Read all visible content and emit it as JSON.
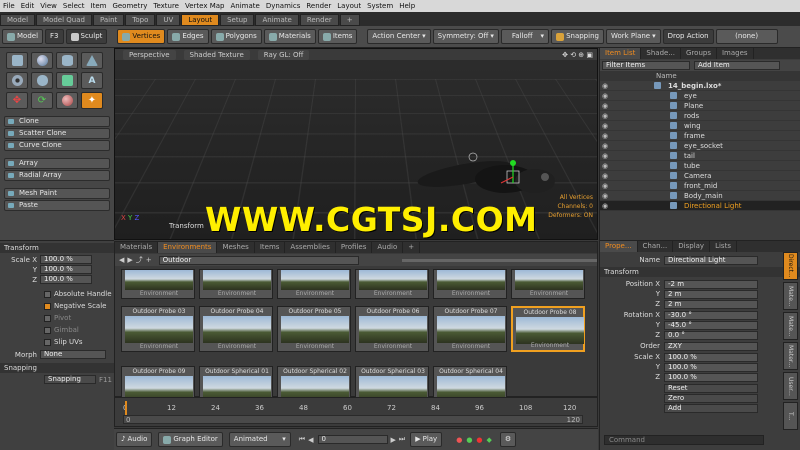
{
  "menubar": [
    "File",
    "Edit",
    "View",
    "Select",
    "Item",
    "Geometry",
    "Texture",
    "Vertex Map",
    "Animate",
    "Dynamics",
    "Render",
    "Layout",
    "System",
    "Help"
  ],
  "layout_tabs": [
    {
      "label": "Model",
      "active": false
    },
    {
      "label": "Model Quad",
      "active": false
    },
    {
      "label": "Paint",
      "active": false
    },
    {
      "label": "Topo",
      "active": false
    },
    {
      "label": "UV",
      "active": false
    },
    {
      "label": "Layout",
      "active": true
    },
    {
      "label": "Setup",
      "active": false
    },
    {
      "label": "Animate",
      "active": false
    },
    {
      "label": "Render",
      "active": false
    },
    {
      "label": "+",
      "active": false
    }
  ],
  "toolbar": {
    "model": "Model",
    "f3": "F3",
    "sculpt": "Sculpt",
    "vertices": "Vertices",
    "edges": "Edges",
    "polygons": "Polygons",
    "materials": "Materials",
    "items": "Items",
    "action_center": "Action Center",
    "symmetry": "Symmetry: Off",
    "falloff": "Falloff",
    "snapping": "Snapping",
    "work_plane": "Work Plane",
    "drop_action": "Drop Action",
    "none": "(none)"
  },
  "left_buttons": [
    "Clone",
    "Scatter Clone",
    "Curve Clone",
    "Array",
    "Radial Array",
    "Mesh Paint",
    "Paste"
  ],
  "viewport": {
    "perspective": "Perspective",
    "shaded": "Shaded Texture",
    "raygl": "Ray GL: Off",
    "transform": "Transform",
    "info_vertices": "All Vertices",
    "info_channels": "Channels: 0",
    "info_sel": "Deformers: ON"
  },
  "watermark": "WWW.CGTSJ.COM",
  "itemlist": {
    "tabs": [
      {
        "label": "Item List",
        "active": true
      },
      {
        "label": "Shade...",
        "active": false
      },
      {
        "label": "Groups",
        "active": false
      },
      {
        "label": "Images",
        "active": false
      }
    ],
    "filter": "Filter Items",
    "add_item": "Add Item",
    "name_header": "Name",
    "items": [
      {
        "name": "14_begin.lxo*",
        "selected": false
      },
      {
        "name": "eye",
        "selected": false
      },
      {
        "name": "Plane",
        "selected": false
      },
      {
        "name": "rods",
        "selected": false
      },
      {
        "name": "wing",
        "selected": false
      },
      {
        "name": "frame",
        "selected": false
      },
      {
        "name": "eye_socket",
        "selected": false
      },
      {
        "name": "tail",
        "selected": false
      },
      {
        "name": "tube",
        "selected": false
      },
      {
        "name": "Camera",
        "selected": false
      },
      {
        "name": "front_mid",
        "selected": false
      },
      {
        "name": "Body_main",
        "selected": false
      },
      {
        "name": "Directional Light",
        "selected": true
      }
    ]
  },
  "transform_panel": {
    "title": "Transform",
    "scale_x_label": "Scale X",
    "scale_x": "100.0 %",
    "y_label": "Y",
    "scale_y": "100.0 %",
    "z_label": "Z",
    "scale_z": "100.0 %",
    "absolute_handle": "Absolute Handle",
    "negative_scale": "Negative Scale",
    "pivot": "Pivot",
    "gimbal": "Gimbal",
    "slip_uvs": "Slip UVs",
    "morph_label": "Morph",
    "morph": "None",
    "snapping_title": "Snapping",
    "snapping": "Snapping",
    "snapping_key": "F11"
  },
  "browser": {
    "tabs": [
      {
        "label": "Materials",
        "active": false
      },
      {
        "label": "Environments",
        "active": true
      },
      {
        "label": "Meshes",
        "active": false
      },
      {
        "label": "Items",
        "active": false
      },
      {
        "label": "Assemblies",
        "active": false
      },
      {
        "label": "Profiles",
        "active": false
      },
      {
        "label": "Audio",
        "active": false
      },
      {
        "label": "+",
        "active": false
      }
    ],
    "path": "Outdoor",
    "row0": [
      "Environment",
      "Environment",
      "Environment",
      "Environment",
      "Environment",
      "Environment"
    ],
    "presets": [
      {
        "name": "Outdoor Probe 03",
        "foot": "Environment",
        "selected": false
      },
      {
        "name": "Outdoor Probe 04",
        "foot": "Environment",
        "selected": false
      },
      {
        "name": "Outdoor Probe 05",
        "foot": "Environment",
        "selected": false
      },
      {
        "name": "Outdoor Probe 06",
        "foot": "Environment",
        "selected": false
      },
      {
        "name": "Outdoor Probe 07",
        "foot": "Environment",
        "selected": false
      },
      {
        "name": "Outdoor Probe 08",
        "foot": "Environment",
        "selected": true
      },
      {
        "name": "Outdoor Probe 09",
        "foot": "",
        "selected": false
      },
      {
        "name": "Outdoor Spherical 01",
        "foot": "",
        "selected": false
      },
      {
        "name": "Outdoor Spherical 02",
        "foot": "",
        "selected": false
      },
      {
        "name": "Outdoor Spherical 03",
        "foot": "",
        "selected": false
      },
      {
        "name": "Outdoor Spherical 04",
        "foot": "",
        "selected": false
      }
    ]
  },
  "timeline": {
    "ticks": [
      "0",
      "12",
      "24",
      "36",
      "48",
      "60",
      "72",
      "84",
      "96",
      "108",
      "120"
    ],
    "sub_ticks": [
      "0",
      "120"
    ]
  },
  "bottombar": {
    "audio": "Audio",
    "graph_editor": "Graph Editor",
    "animated": "Animated",
    "frame": "0",
    "play": "Play",
    "settings": "Settings"
  },
  "props": {
    "tabs": [
      {
        "label": "Prope...",
        "active": true
      },
      {
        "label": "Chan...",
        "active": false
      },
      {
        "label": "Display",
        "active": false
      },
      {
        "label": "Lists",
        "active": false
      }
    ],
    "name_label": "Name",
    "name": "Directional Light",
    "transform": "Transform",
    "position_x_label": "Position X",
    "pos_x": "-2 m",
    "pos_y": "2 m",
    "pos_z": "2 m",
    "rotation_x_label": "Rotation X",
    "rot_x": "-30.0 °",
    "rot_y": "-45.0 °",
    "rot_z": "0.0 °",
    "order_label": "Order",
    "order": "ZXY",
    "scale_x_label": "Scale X",
    "scl_x": "100.0 %",
    "scl_y": "100.0 %",
    "scl_z": "100.0 %",
    "y": "Y",
    "z": "Z",
    "reset": "Reset",
    "zero": "Zero",
    "add": "Add",
    "command": "Command"
  },
  "side_tabs": [
    {
      "label": "Direct...",
      "active": true
    },
    {
      "label": "Mate...",
      "active": false
    },
    {
      "label": "Mate...",
      "active": false
    },
    {
      "label": "Mater...",
      "active": false
    },
    {
      "label": "User...",
      "active": false
    },
    {
      "label": "T...",
      "active": false
    }
  ]
}
